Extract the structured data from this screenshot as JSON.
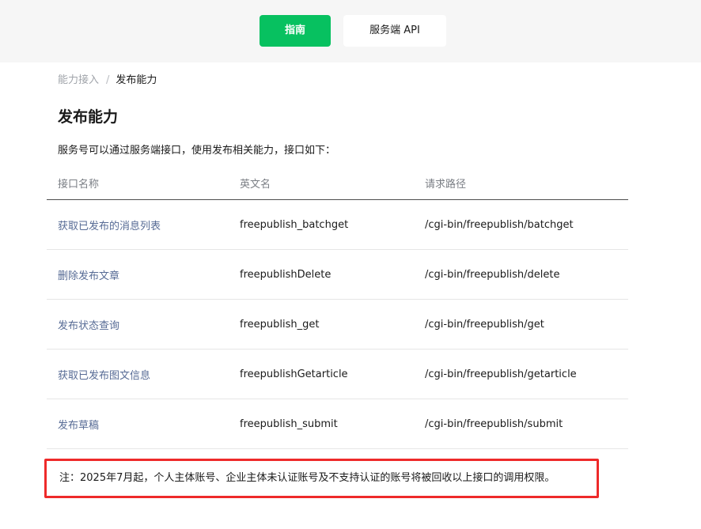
{
  "nav": {
    "tabs": [
      {
        "label": "指南",
        "active": true
      },
      {
        "label": "服务端 API",
        "active": false
      }
    ]
  },
  "breadcrumb": {
    "parent": "能力接入",
    "separator": "/",
    "current": "发布能力"
  },
  "page": {
    "title": "发布能力",
    "intro": "服务号可以通过服务端接口，使用发布相关能力，接口如下："
  },
  "table": {
    "headers": [
      "接口名称",
      "英文名",
      "请求路径"
    ],
    "rows": [
      {
        "name": "获取已发布的消息列表",
        "english": "freepublish_batchget",
        "path": "/cgi-bin/freepublish/batchget"
      },
      {
        "name": "删除发布文章",
        "english": "freepublishDelete",
        "path": "/cgi-bin/freepublish/delete"
      },
      {
        "name": "发布状态查询",
        "english": "freepublish_get",
        "path": "/cgi-bin/freepublish/get"
      },
      {
        "name": "获取已发布图文信息",
        "english": "freepublishGetarticle",
        "path": "/cgi-bin/freepublish/getarticle"
      },
      {
        "name": "发布草稿",
        "english": "freepublish_submit",
        "path": "/cgi-bin/freepublish/submit"
      }
    ]
  },
  "note": {
    "text": "注：2025年7月起，个人主体账号、企业主体未认证账号及不支持认证的账号将被回收以上接口的调用权限。"
  },
  "colors": {
    "accent_green": "#07c160",
    "link_blue": "#576b95",
    "highlight_red": "#ee2a2a",
    "topbar_bg": "#f6f6f6"
  }
}
